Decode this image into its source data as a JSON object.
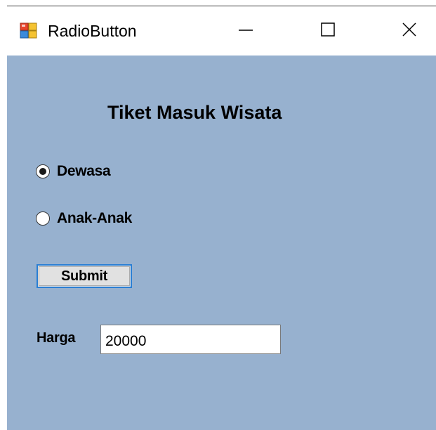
{
  "window": {
    "title": "RadioButton",
    "icon": "winforms-app-icon",
    "controls": {
      "minimize_icon": "minimize-icon",
      "maximize_icon": "maximize-icon",
      "close_icon": "close-icon"
    }
  },
  "form": {
    "heading": "Tiket Masuk Wisata",
    "background_color": "#97b1cf",
    "radios": [
      {
        "label": "Dewasa",
        "checked": true
      },
      {
        "label": "Anak-Anak",
        "checked": false
      }
    ],
    "submit_label": "Submit",
    "price_label": "Harga",
    "price_value": "20000"
  }
}
